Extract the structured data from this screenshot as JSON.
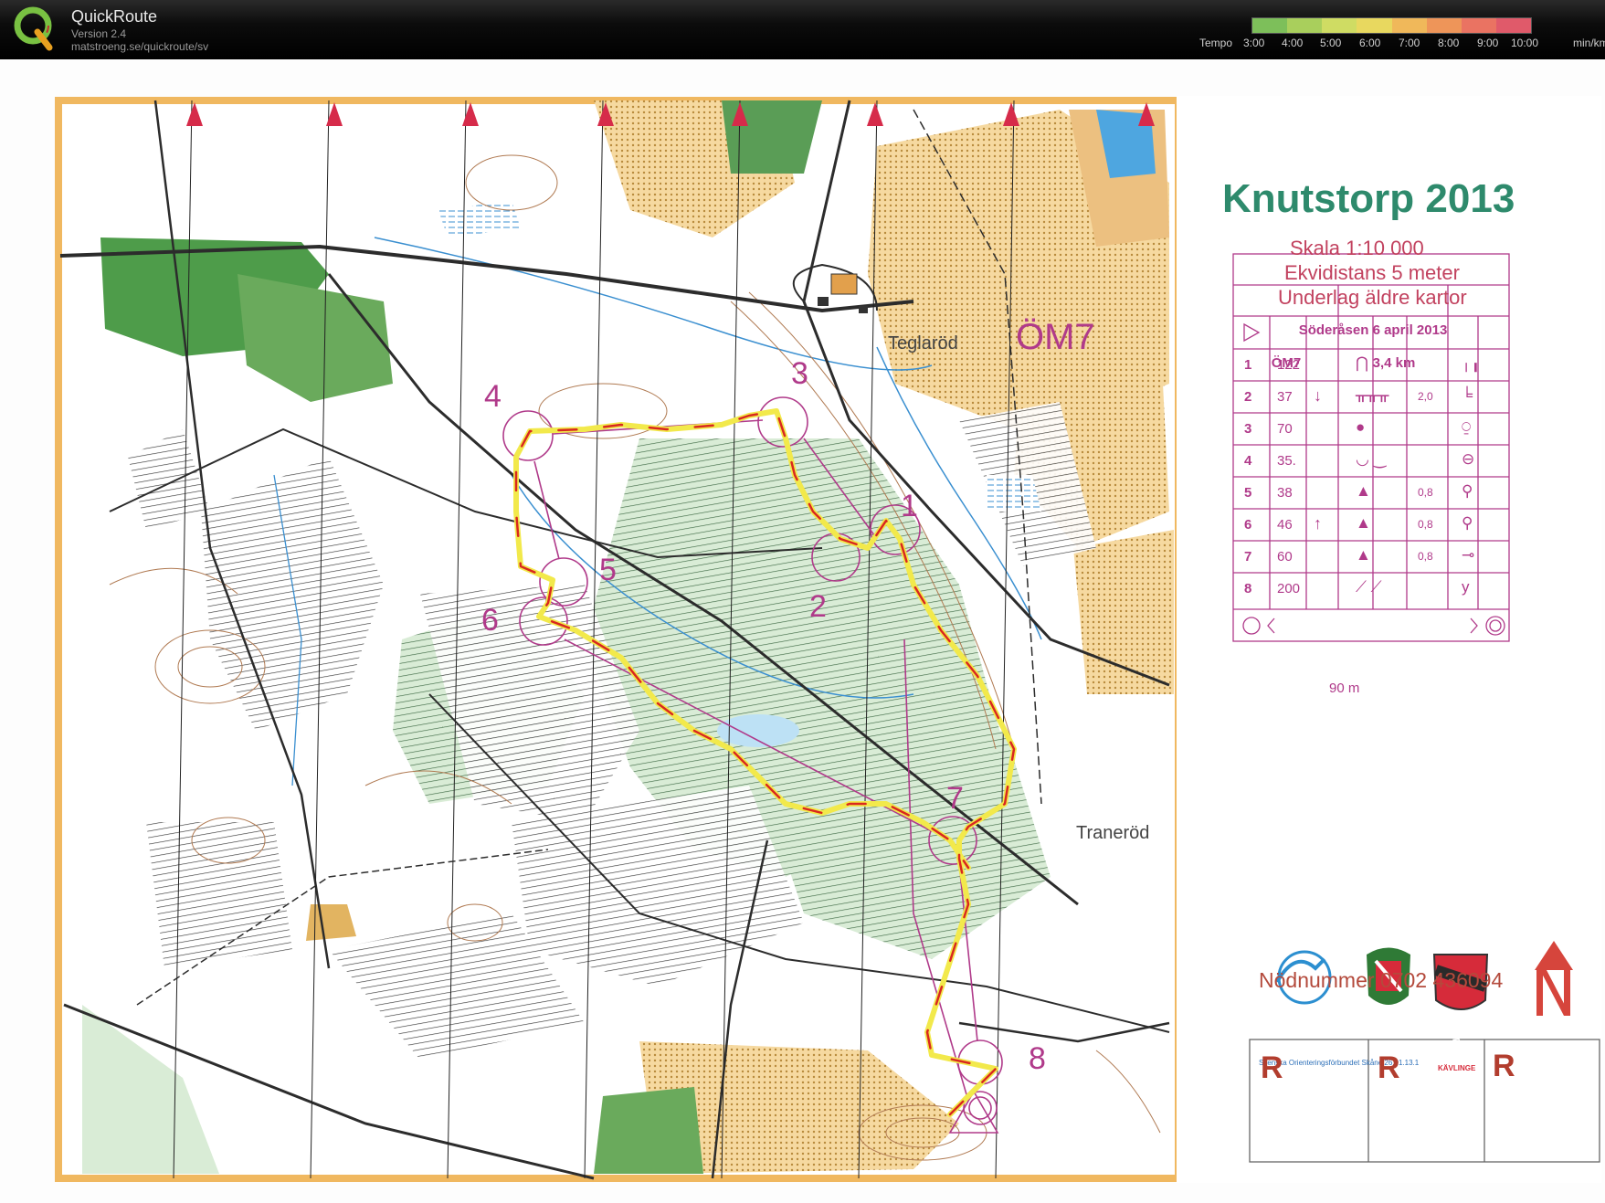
{
  "app": {
    "name": "QuickRoute",
    "version": "Version 2.4",
    "url": "matstroeng.se/quickroute/sv"
  },
  "pace_legend": {
    "label": "Tempo",
    "ticks": [
      "3:00",
      "4:00",
      "5:00",
      "6:00",
      "7:00",
      "8:00",
      "9:00",
      "10:00"
    ],
    "unit": "min/km",
    "colors": [
      "#7dbf5a",
      "#a9cf5c",
      "#cfdc63",
      "#e8d85f",
      "#f0b85a",
      "#ee9559",
      "#ea7362",
      "#e05a6a"
    ]
  },
  "map": {
    "title": "Knutstorp 2013",
    "scale": "Skala 1:10 000",
    "equidistance": "Ekvidistans 5 meter",
    "base": "Underlag äldre kartor",
    "class_label": "ÖM7",
    "place_names": [
      "Teglaröd",
      "Traneröd"
    ],
    "emergency": "Nödnummer 0702 436094",
    "controls": [
      "1",
      "2",
      "3",
      "4",
      "5",
      "6",
      "7",
      "8"
    ],
    "route_colors": {
      "fast": "#f2e94b",
      "slow": "#d9281f"
    },
    "course_color": "#b03a8a"
  },
  "control_descriptions": {
    "event": "Söderåsen 6 april 2013",
    "class": "ÖM7",
    "length": "3,4 km",
    "rows": [
      {
        "n": "1",
        "code": "122",
        "dir": "",
        "feature": "⋂",
        "dim": "",
        "loc": "╷╻"
      },
      {
        "n": "2",
        "code": "37",
        "dir": "↓",
        "feature": "ᚂᚂᚂ",
        "dim": "2,0",
        "loc": "╘"
      },
      {
        "n": "3",
        "code": "70",
        "dir": "",
        "feature": "●",
        "dim": "",
        "loc": "⍜"
      },
      {
        "n": "4",
        "code": "35.",
        "dir": "",
        "feature": "◡  ‿",
        "dim": "",
        "loc": "⊖"
      },
      {
        "n": "5",
        "code": "38",
        "dir": "",
        "feature": "▲",
        "dim": "0,8",
        "loc": "⚲"
      },
      {
        "n": "6",
        "code": "46",
        "dir": "↑",
        "feature": "▲",
        "dim": "0,8",
        "loc": "⚲"
      },
      {
        "n": "7",
        "code": "60",
        "dir": "",
        "feature": "▲",
        "dim": "0,8",
        "loc": "⊸"
      },
      {
        "n": "8",
        "code": "200",
        "dir": "",
        "feature": "⟋ ⟋",
        "dim": "",
        "loc": "y"
      }
    ],
    "finish_distance": "90 m"
  },
  "logos": {
    "sok_text": "Svenska Orienteringsförbundet Skåne 26.01.13.1",
    "club": "FOK",
    "silva": "SILVA",
    "kavlinge": "KÄVLINGE"
  },
  "runner_boxes": [
    "R",
    "R",
    "R"
  ]
}
